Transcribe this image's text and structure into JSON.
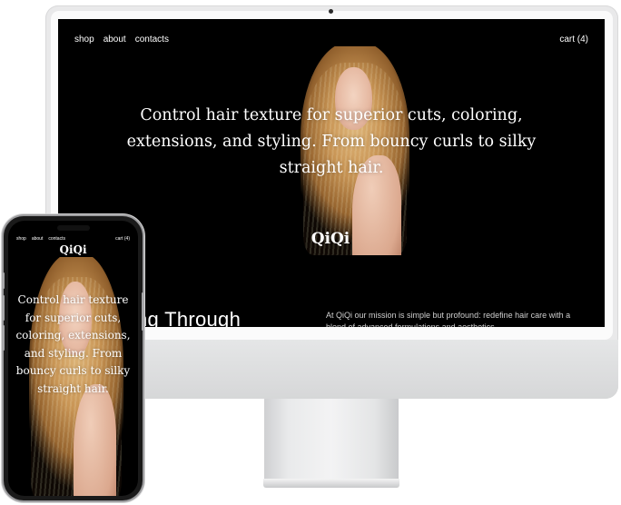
{
  "desktop": {
    "nav": {
      "shop": "shop",
      "about": "about",
      "contacts": "contacts",
      "cart": "cart (4)"
    },
    "hero_text": "Control hair texture for superior cuts, coloring, extensions, and styling. From bouncy curls to silky straight hair.",
    "logo": "QiQi",
    "section_heading": "ng Through",
    "mission_text": "At QiQi our mission is simple but profound: redefine hair care with a blend of advanced formulations and aesthetics"
  },
  "mobile": {
    "nav": {
      "shop": "shop",
      "about": "about",
      "contacts": "contacts",
      "cart": "cart (4)"
    },
    "logo": "QiQi",
    "hero_text": "Control hair texture for superior cuts, coloring, extensions, and styling. From bouncy curls to silky straight hair."
  },
  "colors": {
    "screen_bg": "#000000",
    "text": "#ffffff",
    "device_silver": "#e9e9ea",
    "hair": "#c49256"
  }
}
